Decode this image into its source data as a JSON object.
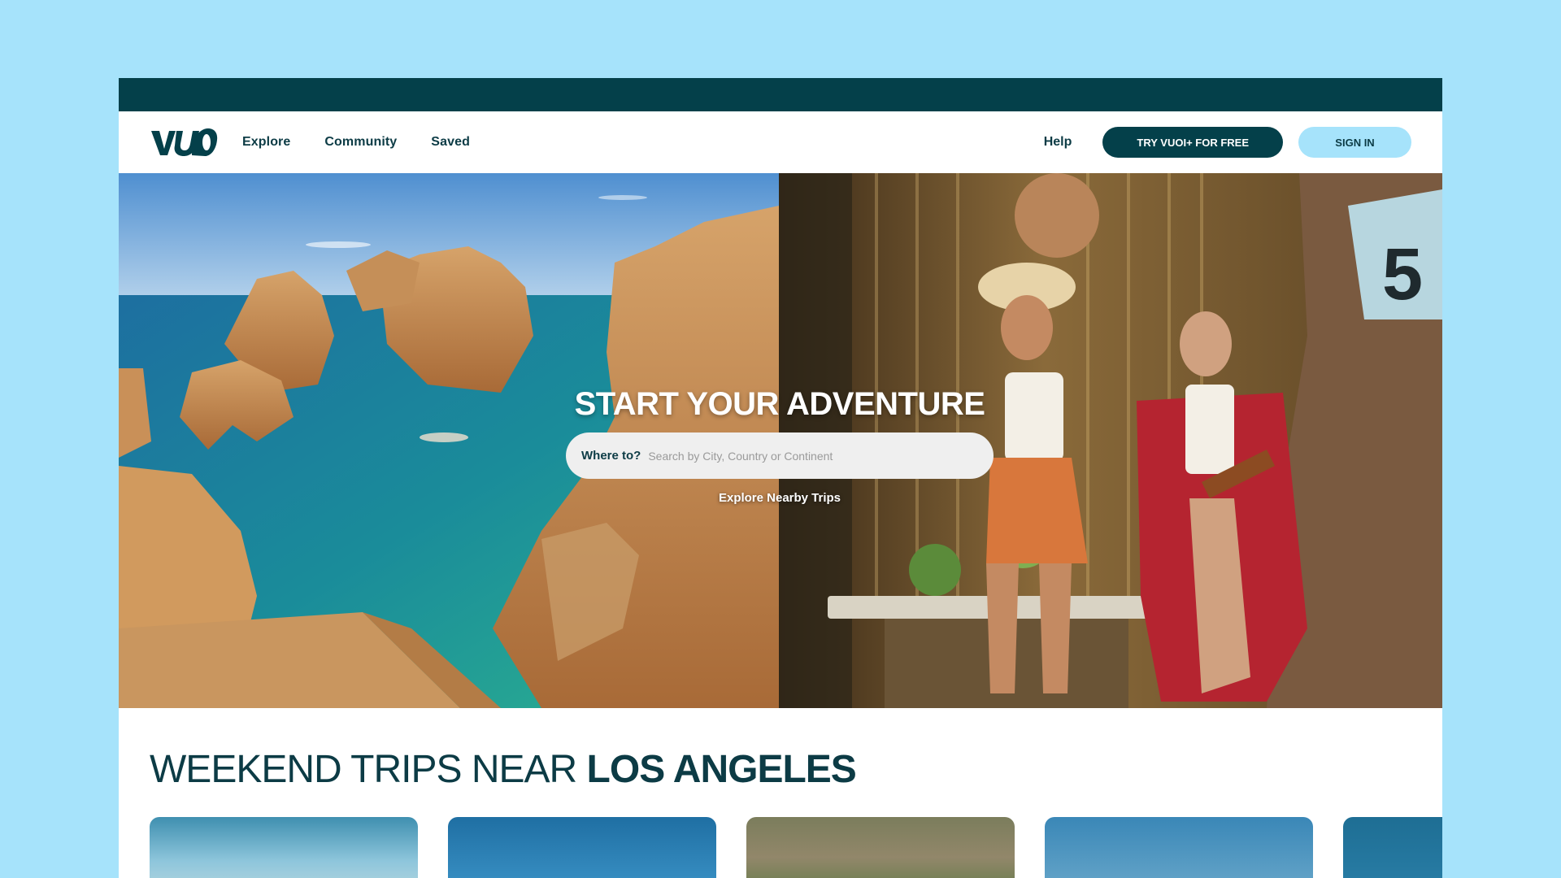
{
  "brand": {
    "logo_text": "VUO"
  },
  "nav": {
    "links": [
      "Explore",
      "Community",
      "Saved"
    ],
    "help": "Help",
    "try_button": "TRY VUOI+ FOR FREE",
    "signin_button": "SIGN IN"
  },
  "hero": {
    "title": "START YOUR ADVENTURE",
    "search_label": "Where to?",
    "search_placeholder": "Search by City, Country or Continent",
    "explore_link": "Explore Nearby Trips",
    "sign_number": "5"
  },
  "section": {
    "title_light": "WEEKEND TRIPS NEAR ",
    "title_bold": "LOS ANGELES"
  },
  "colors": {
    "background": "#a6e3fb",
    "brand_dark": "#04404a",
    "text_dark": "#0c3b45",
    "accent_light": "#a6e3fb"
  },
  "icons": [
    "vuo-logo"
  ]
}
